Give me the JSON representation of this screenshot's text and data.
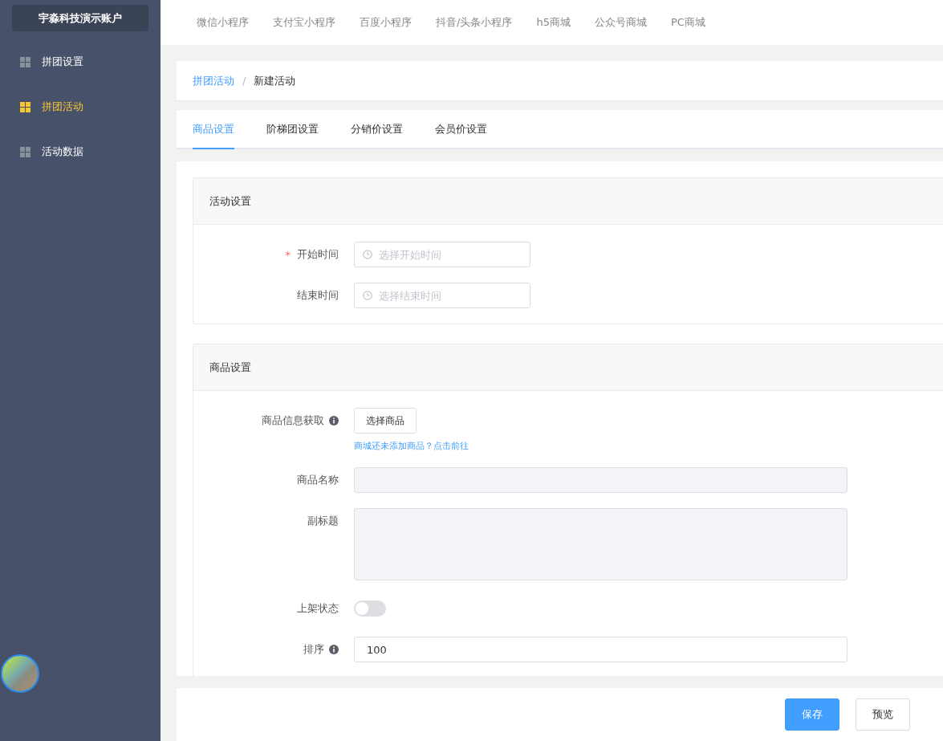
{
  "sidebar": {
    "account": "宇淼科技演示账户",
    "items": [
      {
        "label": "拼团设置",
        "selected": false
      },
      {
        "label": "拼团活动",
        "selected": true
      },
      {
        "label": "活动数据",
        "selected": false
      }
    ]
  },
  "top_nav": [
    "微信小程序",
    "支付宝小程序",
    "百度小程序",
    "抖音/头条小程序",
    "h5商城",
    "公众号商城",
    "PC商城"
  ],
  "breadcrumb": [
    "拼团活动",
    "新建活动"
  ],
  "breadcrumb_separator": "/",
  "required_marker": "*",
  "tabs": [
    {
      "label": "商品设置",
      "selected": true
    },
    {
      "label": "阶梯团设置",
      "selected": false
    },
    {
      "label": "分销价设置",
      "selected": false
    },
    {
      "label": "会员价设置",
      "selected": false
    }
  ],
  "sections": [
    {
      "title": "活动设置",
      "fields": [
        {
          "kind": "time",
          "label": "开始时间",
          "required": true,
          "info": false,
          "placeholder": "选择开始时间"
        },
        {
          "kind": "time",
          "label": "结束时间",
          "required": false,
          "info": false,
          "placeholder": "选择结束时间"
        }
      ]
    },
    {
      "title": "商品设置",
      "fields": [
        {
          "kind": "button",
          "label": "商品信息获取",
          "required": false,
          "info": true,
          "button": "选择商品",
          "link": "商城还未添加商品？点击前往"
        },
        {
          "kind": "input",
          "label": "商品名称",
          "required": false,
          "info": false,
          "disabled": true
        },
        {
          "kind": "textarea",
          "label": "副标题",
          "required": false,
          "info": false,
          "disabled": true
        },
        {
          "kind": "switch",
          "label": "上架状态",
          "required": false,
          "info": false,
          "on": false
        },
        {
          "kind": "input",
          "label": "排序",
          "required": false,
          "info": true,
          "disabled": false,
          "value": "100"
        }
      ]
    }
  ],
  "footer": {
    "buttons": [
      {
        "label": "保存",
        "kind": "primary"
      },
      {
        "label": "预览",
        "kind": "default"
      }
    ]
  }
}
